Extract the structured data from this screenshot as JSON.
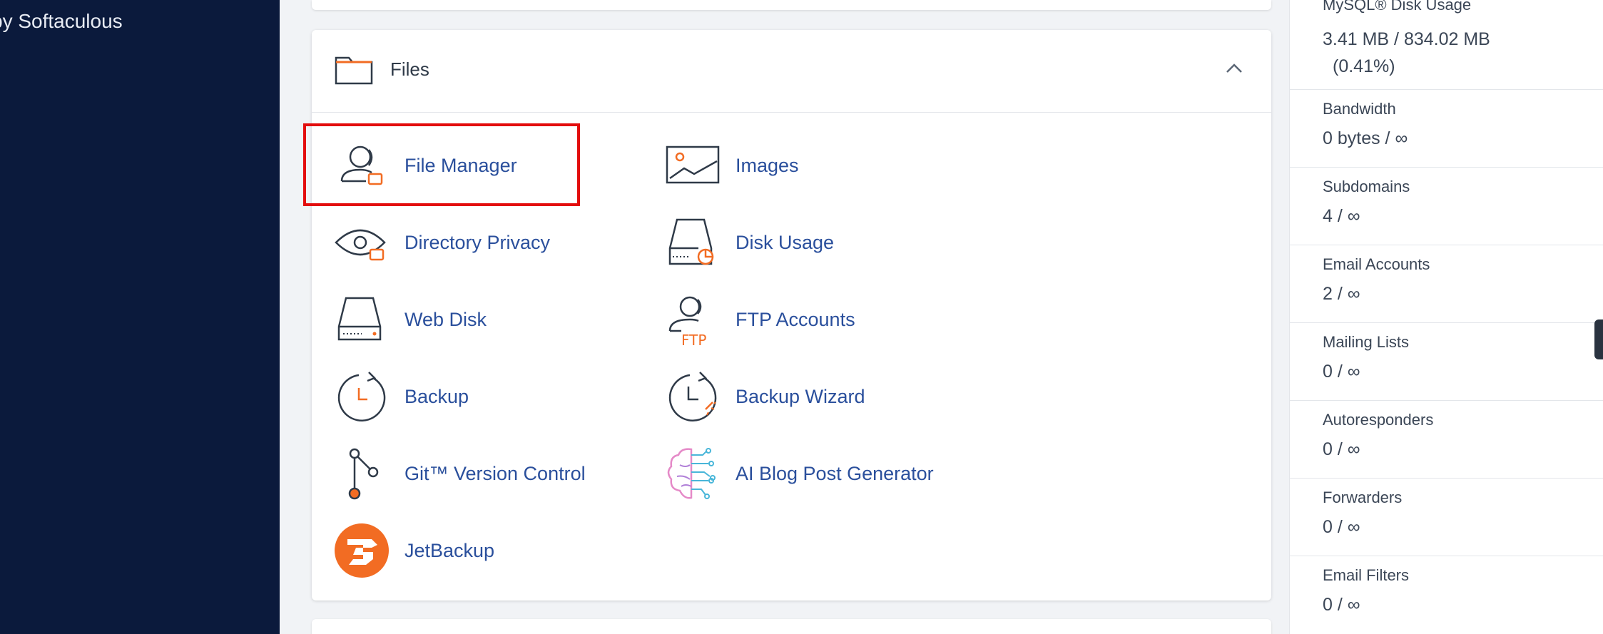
{
  "sidebar": {
    "brand_text": "by Softaculous"
  },
  "files_section": {
    "title": "Files",
    "items": [
      {
        "label": "File Manager",
        "icon": "file-manager-icon"
      },
      {
        "label": "Images",
        "icon": "images-icon"
      },
      {
        "label": "Directory Privacy",
        "icon": "directory-privacy-icon"
      },
      {
        "label": "Disk Usage",
        "icon": "disk-usage-icon"
      },
      {
        "label": "Web Disk",
        "icon": "web-disk-icon"
      },
      {
        "label": "FTP Accounts",
        "icon": "ftp-accounts-icon"
      },
      {
        "label": "Backup",
        "icon": "backup-icon"
      },
      {
        "label": "Backup Wizard",
        "icon": "backup-wizard-icon"
      },
      {
        "label": "Git™ Version Control",
        "icon": "git-icon"
      },
      {
        "label": "AI Blog Post Generator",
        "icon": "ai-brain-icon"
      },
      {
        "label": "JetBackup",
        "icon": "jetbackup-icon"
      }
    ],
    "ftp_badge": "FTP"
  },
  "stats": {
    "mysql": {
      "label": "MySQL® Disk Usage",
      "value": "3.41 MB / 834.02 MB",
      "percent": "(0.41%)"
    },
    "bandwidth": {
      "label": "Bandwidth",
      "value": "0 bytes / ∞"
    },
    "subdomains": {
      "label": "Subdomains",
      "value": "4 / ∞"
    },
    "email_accounts": {
      "label": "Email Accounts",
      "value": "2 / ∞"
    },
    "mailing_lists": {
      "label": "Mailing Lists",
      "value": "0 / ∞"
    },
    "autoresponders": {
      "label": "Autoresponders",
      "value": "0 / ∞"
    },
    "forwarders": {
      "label": "Forwarders",
      "value": "0 / ∞"
    },
    "email_filters": {
      "label": "Email Filters",
      "value": "0 / ∞"
    }
  },
  "colors": {
    "sidebar_bg": "#0b1a3c",
    "link": "#2a4f9c",
    "accent_orange": "#f26c23",
    "highlight_red": "#e30d0d"
  }
}
